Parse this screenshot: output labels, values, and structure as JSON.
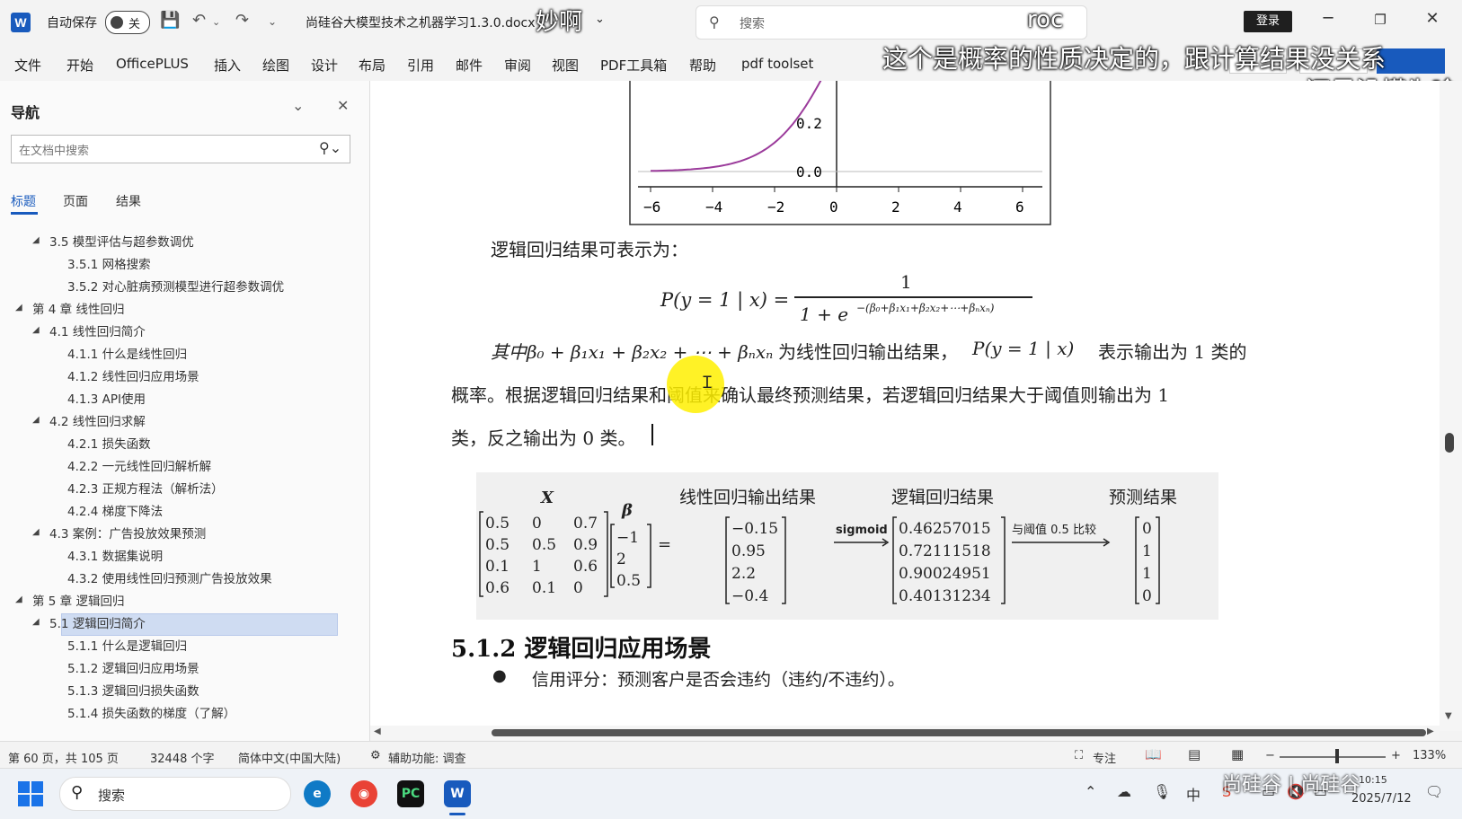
{
  "titlebar": {
    "word_logo": "W",
    "autosave_label": "自动保存",
    "autosave_state": "关",
    "doc_title": "尚硅谷大模型技术之机器学习1.3.0.docx",
    "title_overlay": "妙啊",
    "search_placeholder": "搜索",
    "search_overlay": "roc",
    "login_label": "登录"
  },
  "subtitles": {
    "line1": "这个是概率的性质决定的，跟计算结果没关系",
    "line2": "还是没懂为啥"
  },
  "ribbon": {
    "tabs": [
      "文件",
      "开始",
      "OfficePLUS",
      "插入",
      "绘图",
      "设计",
      "布局",
      "引用",
      "邮件",
      "审阅",
      "视图",
      "PDF工具箱",
      "帮助",
      "pdf toolset"
    ]
  },
  "nav": {
    "title": "导航",
    "search_placeholder": "在文档中搜索",
    "tabs": [
      "标题",
      "页面",
      "结果"
    ],
    "items": [
      {
        "label": "3.5 模型评估与超参数调优",
        "level": 2,
        "arrow": "◢"
      },
      {
        "label": "3.5.1 网格搜索",
        "level": 3
      },
      {
        "label": "3.5.2 对心脏病预测模型进行超参数调优",
        "level": 3
      },
      {
        "label": "第 4 章 线性回归",
        "level": 1,
        "arrow": "◢"
      },
      {
        "label": "4.1 线性回归简介",
        "level": 2,
        "arrow": "◢"
      },
      {
        "label": "4.1.1 什么是线性回归",
        "level": 3
      },
      {
        "label": "4.1.2 线性回归应用场景",
        "level": 3
      },
      {
        "label": "4.1.3 API使用",
        "level": 3
      },
      {
        "label": "4.2 线性回归求解",
        "level": 2,
        "arrow": "◢"
      },
      {
        "label": "4.2.1 损失函数",
        "level": 3
      },
      {
        "label": "4.2.2 一元线性回归解析解",
        "level": 3
      },
      {
        "label": "4.2.3 正规方程法（解析法）",
        "level": 3
      },
      {
        "label": "4.2.4 梯度下降法",
        "level": 3
      },
      {
        "label": "4.3 案例：广告投放效果预测",
        "level": 2,
        "arrow": "◢"
      },
      {
        "label": "4.3.1 数据集说明",
        "level": 3
      },
      {
        "label": "4.3.2 使用线性回归预测广告投放效果",
        "level": 3
      },
      {
        "label": "第 5 章 逻辑回归",
        "level": 1,
        "arrow": "◢"
      },
      {
        "label": "5.1 逻辑回归简介",
        "level": 2,
        "arrow": "◢"
      },
      {
        "label": "5.1.1 什么是逻辑回归",
        "level": 3,
        "selected": true
      },
      {
        "label": "5.1.2 逻辑回归应用场景",
        "level": 3
      },
      {
        "label": "5.1.3 逻辑回归损失函数",
        "level": 3
      },
      {
        "label": "5.1.4 损失函数的梯度（了解）",
        "level": 3
      }
    ]
  },
  "document": {
    "para_intro": "逻辑回归结果可表示为：",
    "formula_lhs": "P(y = 1 | x) =",
    "formula_num": "1",
    "formula_den": "1 + e",
    "formula_exp": "−(β₀+β₁x₁+β₂x₂+⋯+βₙxₙ)",
    "para2_line1_a": "其中β₀ + β₁x₁ + β₂x₂ + ⋯ + βₙxₙ",
    "para2_line1_b": "为线性回归输出结果，",
    "para2_line1_c": "P(y = 1 | x)",
    "para2_line1_d": "表示输出为 1 类的",
    "para2_line2": "概率。根据逻辑回归结果和阈值来确认最终预测结果，若逻辑回归结果大于阈值则输出为 1",
    "para2_line3": "类，反之输出为 0 类。",
    "heading": "5.1.2 逻辑回归应用场景",
    "bullet1": "信用评分：预测客户是否会违约（违约/不违约）。",
    "figure": {
      "x_label": "X",
      "beta_label": "β",
      "x_rows": [
        [
          "0.5",
          "0",
          "0.7"
        ],
        [
          "0.5",
          "0.5",
          "0.9"
        ],
        [
          "0.1",
          "1",
          "0.6"
        ],
        [
          "0.6",
          "0.1",
          "0"
        ]
      ],
      "beta": [
        "−1",
        "2",
        "0.5"
      ],
      "equals": "=",
      "linear_title": "线性回归输出结果",
      "linear_vals": [
        "−0.15",
        "0.95",
        "2.2",
        "−0.4"
      ],
      "sigmoid_label": "sigmoid",
      "logit_title": "逻辑回归结果",
      "logit_vals": [
        "0.46257015",
        "0.72111518",
        "0.90024951",
        "0.40131234"
      ],
      "compare_label": "与阈值 0.5 比较",
      "pred_title": "预测结果",
      "pred_vals": [
        "0",
        "1",
        "1",
        "0"
      ]
    },
    "plot": {
      "x_ticks": [
        "−6",
        "−4",
        "−2",
        "0",
        "2",
        "4",
        "6"
      ],
      "y_ticks": [
        "0.2",
        "0.0"
      ],
      "curve_color": "#9b3b9b"
    }
  },
  "status": {
    "page": "第 60 页，共 105 页",
    "words": "32448 个字",
    "lang": "简体中文(中国大陆)",
    "accessibility": "辅助功能: 调查",
    "focus": "专注",
    "zoom": "133%"
  },
  "taskbar": {
    "search": "搜索",
    "time": "10:15",
    "date": "2025/7/12",
    "watermark": "尚硅谷 | 尚硅谷"
  }
}
